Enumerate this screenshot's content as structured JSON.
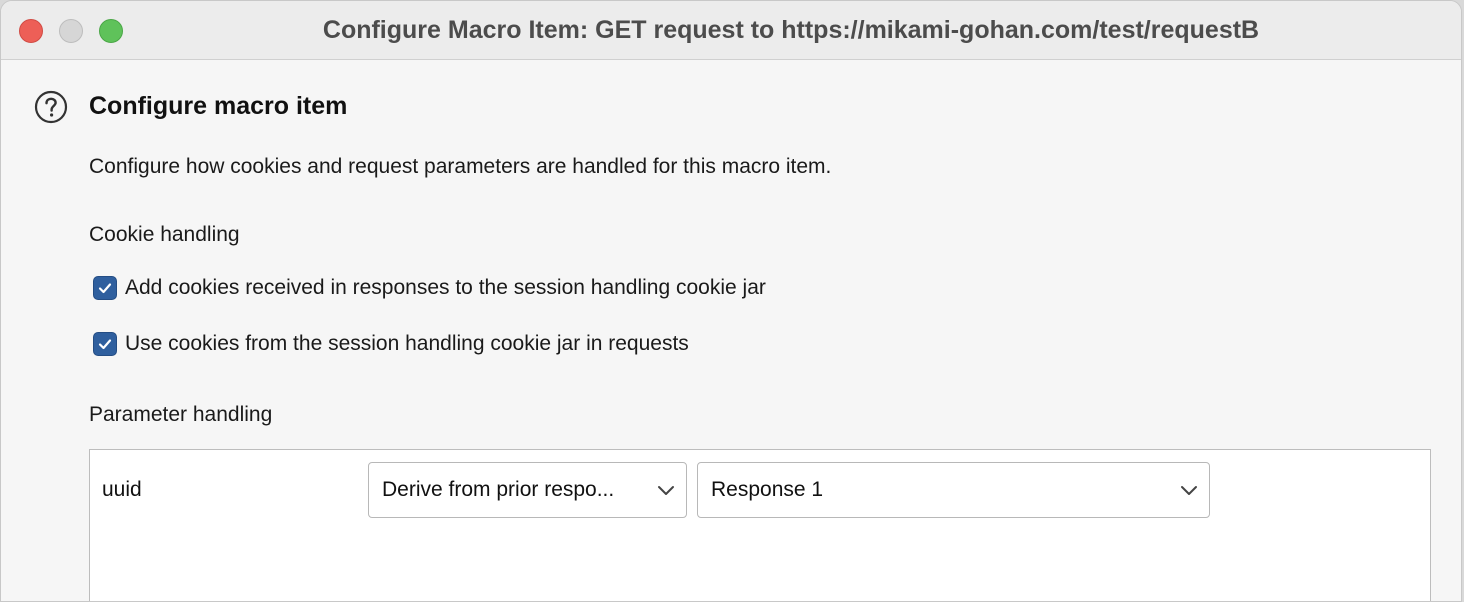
{
  "window": {
    "title": "Configure Macro Item: GET request to https://mikami-gohan.com/test/requestB"
  },
  "header": {
    "heading": "Configure macro item",
    "description": "Configure how cookies and request parameters are handled for this macro item."
  },
  "cookie_handling": {
    "label": "Cookie handling",
    "options": [
      {
        "label": "Add cookies received in responses to the session handling cookie jar",
        "checked": true
      },
      {
        "label": "Use cookies from the session handling cookie jar in requests",
        "checked": true
      }
    ]
  },
  "parameter_handling": {
    "label": "Parameter handling",
    "rows": [
      {
        "name": "uuid",
        "source": "Derive from prior respo...",
        "response": "Response 1"
      }
    ]
  },
  "colors": {
    "checkbox_accent": "#2f5f9e",
    "close_button": "#ed5f57",
    "zoom_button": "#5fc25a"
  },
  "icons": [
    "help-icon",
    "checkmark-icon",
    "chevron-down-icon"
  ]
}
